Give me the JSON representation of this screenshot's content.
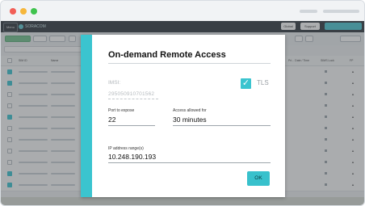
{
  "window": {
    "dots": [
      "#f25f57",
      "#f6b73c",
      "#3fc34d"
    ]
  },
  "nav": {
    "menu_label": "Menu",
    "logo_text": "SORACOM",
    "button_1": "Global",
    "button_2": "Support"
  },
  "table": {
    "headers": [
      "SIM ID",
      "Name",
      "Speed Class",
      "Pri... Date / Time",
      "SIMS Lock",
      "FP"
    ]
  },
  "modal": {
    "title": "On-demand Remote Access",
    "imsi_label": "IMSI:",
    "imsi_value": "295050910701562",
    "tls_label": "TLS",
    "tls_checked": true,
    "port_label": "Port to expose",
    "port_value": "22",
    "access_label": "Access allowed for",
    "access_value": "30 minutes",
    "ip_label": "IP address range(s)",
    "ip_value": "10.248.190.193",
    "ok_label": "OK",
    "accent_color": "#3bc4cf"
  }
}
